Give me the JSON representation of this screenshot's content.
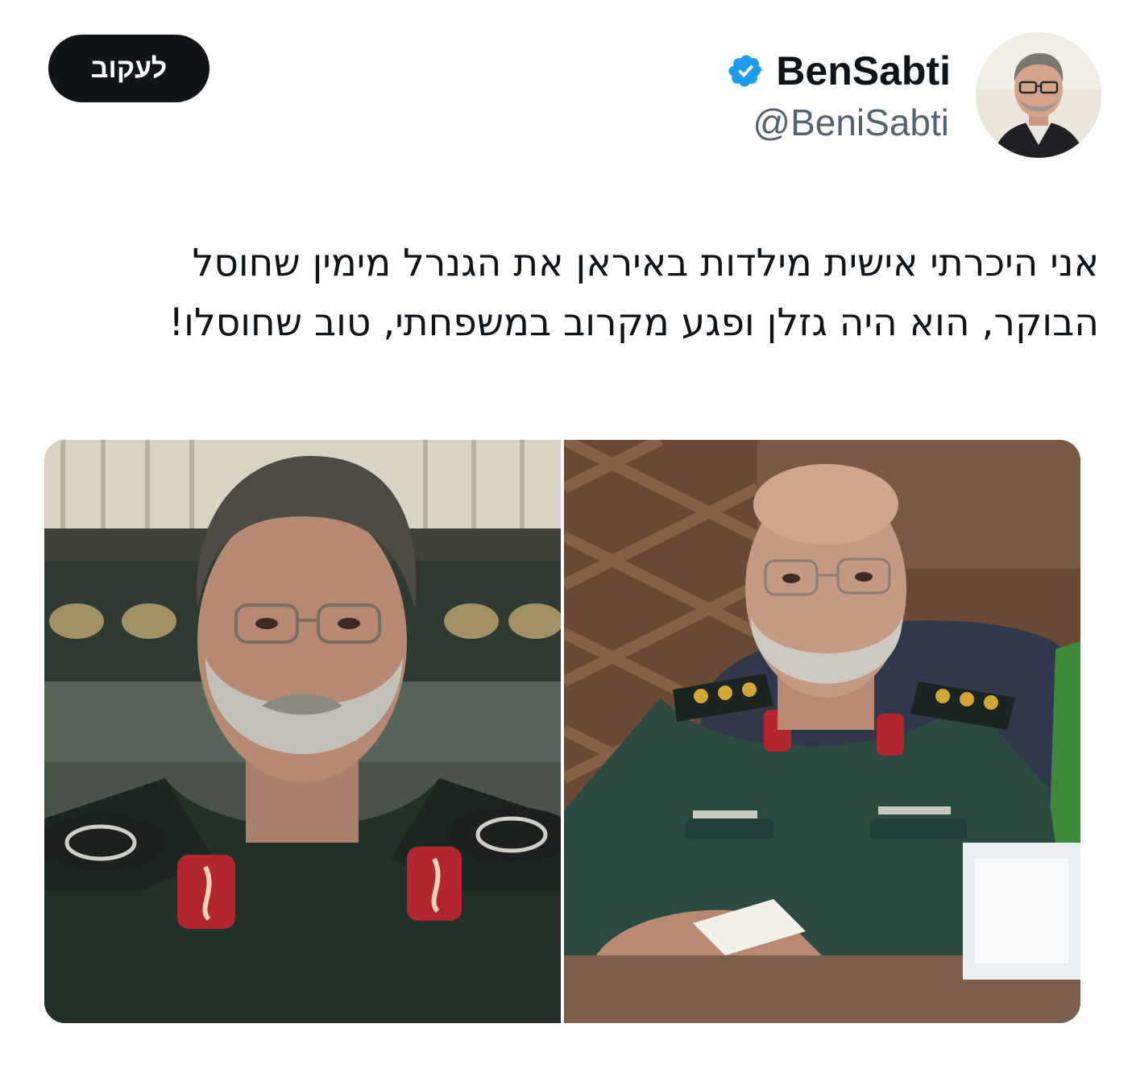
{
  "header": {
    "follow_label": "לעקוב",
    "display_name": "BenSabti",
    "handle": "@BeniSabti",
    "verified_icon": "verified-badge-icon",
    "verified_color": "#1d9bf0"
  },
  "tweet": {
    "lines": [
      "אני היכרתי אישית מילדות באיראן את הגנרל מימין שחוסל",
      "הבוקר, הוא היה גזלן ופגע מקרוב במשפחתי, טוב שחוסלו!"
    ]
  },
  "media": {
    "photos": [
      "portrait-photo-left",
      "portrait-photo-right"
    ]
  },
  "colors": {
    "follow_bg": "#0f1419",
    "text": "#0f1419",
    "secondary_text": "#536471",
    "uniform_green": "#223a30",
    "insignia_red": "#b3262e"
  }
}
